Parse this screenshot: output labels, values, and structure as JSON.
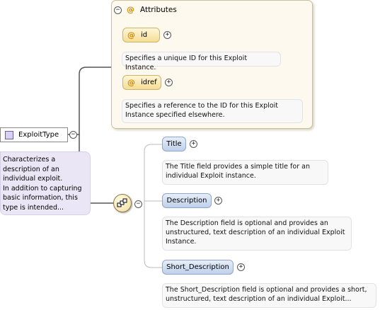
{
  "root": {
    "name": "ExploitType",
    "doc": [
      "Characterizes a",
      "description of an",
      "individual exploit.",
      "In addition to capturing",
      "basic information, this",
      "type is intended..."
    ]
  },
  "attributes_group": {
    "label": "Attributes",
    "items": [
      {
        "name": "id",
        "doc": [
          "Specifies a unique ID for this Exploit Instance."
        ]
      },
      {
        "name": "idref",
        "doc": [
          "Specifies a reference to the ID for this Exploit",
          "Instance specified elsewhere."
        ]
      }
    ]
  },
  "sequence": {
    "elements": [
      {
        "name": "Title",
        "doc": [
          "The Title field provides a simple title for an",
          "individual Exploit instance."
        ]
      },
      {
        "name": "Description",
        "doc": [
          "The Description field is optional and provides an",
          "unstructured, text description of an individual Exploit",
          "Instance."
        ]
      },
      {
        "name": "Short_Description",
        "doc": [
          "The Short_Description field is optional and provides a short,",
          "unstructured, text description of an individual Exploit..."
        ]
      }
    ]
  },
  "symbols": {
    "at": "@",
    "collapse": "−",
    "expand": "+"
  }
}
